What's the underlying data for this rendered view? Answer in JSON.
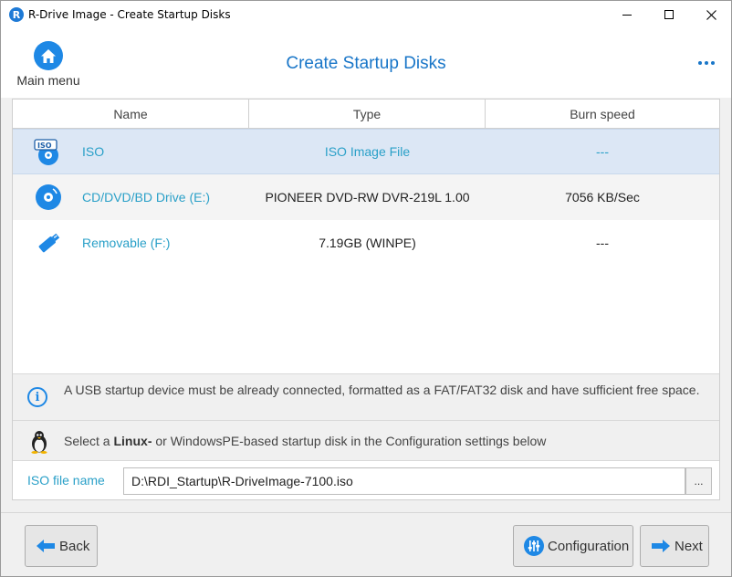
{
  "window": {
    "title": "R-Drive Image - Create Startup Disks",
    "app_icon_letter": "R"
  },
  "header": {
    "home_label": "Main menu",
    "page_title": "Create Startup Disks"
  },
  "table": {
    "columns": [
      "Name",
      "Type",
      "Burn speed"
    ],
    "rows": [
      {
        "icon": "iso-disc-icon",
        "name": "ISO",
        "type": "ISO Image File",
        "speed": "---",
        "selected": true
      },
      {
        "icon": "optical-disc-icon",
        "name": "CD/DVD/BD Drive (E:)",
        "type": "PIONEER DVD-RW DVR-219L 1.00",
        "speed": "7056 KB/Sec",
        "selected": false
      },
      {
        "icon": "usb-drive-icon",
        "name": "Removable (F:)",
        "type": "7.19GB (WINPE)",
        "speed": "---",
        "selected": false
      }
    ]
  },
  "info": {
    "usb_notice": "A USB startup device must be already connected, formatted as a FAT/FAT32 disk and have sufficient free space.",
    "linux_prefix": "Select a ",
    "linux_bold": "Linux-",
    "linux_suffix": " or WindowsPE-based startup disk in the Configuration settings below"
  },
  "iso": {
    "label": "ISO file name",
    "value": "D:\\RDI_Startup\\R-DriveImage-7100.iso",
    "browse_label": "..."
  },
  "footer": {
    "back_label": "Back",
    "config_label": "Configuration",
    "next_label": "Next"
  },
  "colors": {
    "accent": "#1976c8",
    "link": "#2aa0c8",
    "selected_row": "#dce7f5"
  }
}
